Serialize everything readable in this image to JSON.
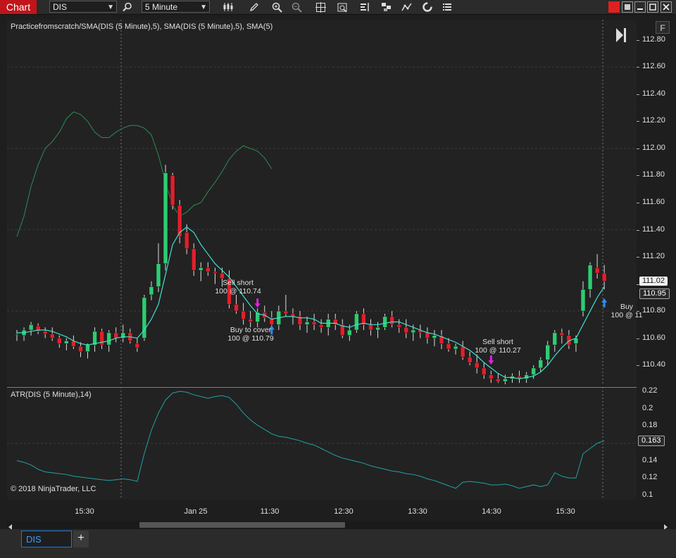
{
  "toolbar": {
    "tab_label": "Chart",
    "instrument": "DIS",
    "interval": "5 Minute",
    "icons": [
      "search-icon",
      "bar-type-icon",
      "pencil-icon",
      "zoom-in-icon",
      "zoom-out-icon",
      "crosshair-icon",
      "data-box-icon",
      "chart-trader-icon",
      "strategies-icon",
      "indicators-icon",
      "reload-icon",
      "properties-icon"
    ]
  },
  "window_controls": {
    "colors": {
      "link": "#e02020"
    }
  },
  "price_panel": {
    "title": "Practicefromscratch/SMA(DIS (5 Minute),5), SMA(DIS (5 Minute),5), SMA(5)",
    "f_label": "F",
    "price_ticks": [
      "112.80",
      "112.60",
      "112.40",
      "112.20",
      "112.00",
      "111.80",
      "111.60",
      "111.40",
      "111.20",
      "111.00",
      "110.80",
      "110.60",
      "110.40"
    ],
    "tags": [
      {
        "text": "111.02",
        "style": "white"
      },
      {
        "text": "110.95",
        "style": "dark"
      }
    ],
    "annotations": [
      {
        "line1": "Sell short",
        "line2": "100 @ 110.74"
      },
      {
        "line1": "Buy to cover",
        "line2": "100 @ 110.79"
      },
      {
        "line1": "Sell short",
        "line2": "100 @ 110.27"
      },
      {
        "line1": "Buy",
        "line2": "100 @ 11"
      }
    ]
  },
  "atr_panel": {
    "title": "ATR(DIS (5 Minute),14)",
    "ticks": [
      "0.22",
      "0.2",
      "0.18",
      "0.16",
      "0.14",
      "0.12",
      "0.1"
    ],
    "tag": "0.163",
    "copyright": "© 2018 NinjaTrader, LLC"
  },
  "time_axis": [
    "15:30",
    "Jan 25",
    "11:30",
    "12:30",
    "13:30",
    "14:30",
    "15:30"
  ],
  "bottom": {
    "tab": "DIS",
    "add": "+"
  },
  "chart_data": {
    "type": "candlestick",
    "instrument": "DIS",
    "interval": "5 Minute",
    "ylim": [
      110.25,
      112.95
    ],
    "candles": [
      {
        "o": 110.63,
        "h": 110.66,
        "l": 110.58,
        "c": 110.63
      },
      {
        "o": 110.62,
        "h": 110.68,
        "l": 110.58,
        "c": 110.66
      },
      {
        "o": 110.66,
        "h": 110.72,
        "l": 110.62,
        "c": 110.7
      },
      {
        "o": 110.69,
        "h": 110.71,
        "l": 110.63,
        "c": 110.65
      },
      {
        "o": 110.65,
        "h": 110.68,
        "l": 110.6,
        "c": 110.63
      },
      {
        "o": 110.63,
        "h": 110.68,
        "l": 110.58,
        "c": 110.6
      },
      {
        "o": 110.6,
        "h": 110.62,
        "l": 110.53,
        "c": 110.56
      },
      {
        "o": 110.56,
        "h": 110.6,
        "l": 110.51,
        "c": 110.58
      },
      {
        "o": 110.58,
        "h": 110.62,
        "l": 110.52,
        "c": 110.54
      },
      {
        "o": 110.54,
        "h": 110.57,
        "l": 110.46,
        "c": 110.5
      },
      {
        "o": 110.5,
        "h": 110.56,
        "l": 110.45,
        "c": 110.55
      },
      {
        "o": 110.55,
        "h": 110.68,
        "l": 110.5,
        "c": 110.65
      },
      {
        "o": 110.65,
        "h": 110.67,
        "l": 110.52,
        "c": 110.55
      },
      {
        "o": 110.55,
        "h": 110.66,
        "l": 110.5,
        "c": 110.64
      },
      {
        "o": 110.64,
        "h": 110.68,
        "l": 110.57,
        "c": 110.6
      },
      {
        "o": 110.6,
        "h": 110.7,
        "l": 110.57,
        "c": 110.64
      },
      {
        "o": 110.64,
        "h": 110.67,
        "l": 110.56,
        "c": 110.58
      },
      {
        "o": 110.56,
        "h": 110.6,
        "l": 110.5,
        "c": 110.53
      },
      {
        "o": 110.6,
        "h": 110.92,
        "l": 110.58,
        "c": 110.9
      },
      {
        "o": 110.92,
        "h": 111.02,
        "l": 110.88,
        "c": 110.98
      },
      {
        "o": 110.98,
        "h": 111.3,
        "l": 110.94,
        "c": 111.15
      },
      {
        "o": 111.15,
        "h": 111.88,
        "l": 111.1,
        "c": 111.82
      },
      {
        "o": 111.8,
        "h": 111.82,
        "l": 111.55,
        "c": 111.58
      },
      {
        "o": 111.58,
        "h": 111.62,
        "l": 111.3,
        "c": 111.35
      },
      {
        "o": 111.38,
        "h": 111.44,
        "l": 111.22,
        "c": 111.26
      },
      {
        "o": 111.26,
        "h": 111.3,
        "l": 111.06,
        "c": 111.1
      },
      {
        "o": 111.1,
        "h": 111.16,
        "l": 111.02,
        "c": 111.12
      },
      {
        "o": 111.12,
        "h": 111.16,
        "l": 111.06,
        "c": 111.09
      },
      {
        "o": 111.09,
        "h": 111.12,
        "l": 111.0,
        "c": 111.08
      },
      {
        "o": 111.08,
        "h": 111.12,
        "l": 110.98,
        "c": 111.04
      },
      {
        "o": 111.04,
        "h": 111.1,
        "l": 110.82,
        "c": 110.85
      },
      {
        "o": 110.85,
        "h": 110.92,
        "l": 110.78,
        "c": 110.8
      },
      {
        "o": 110.8,
        "h": 110.86,
        "l": 110.7,
        "c": 110.74
      },
      {
        "o": 110.74,
        "h": 110.8,
        "l": 110.68,
        "c": 110.72
      },
      {
        "o": 110.72,
        "h": 110.82,
        "l": 110.68,
        "c": 110.79
      },
      {
        "o": 110.79,
        "h": 110.84,
        "l": 110.72,
        "c": 110.75
      },
      {
        "o": 110.75,
        "h": 110.8,
        "l": 110.66,
        "c": 110.7
      },
      {
        "o": 110.7,
        "h": 110.84,
        "l": 110.66,
        "c": 110.8
      },
      {
        "o": 110.8,
        "h": 110.92,
        "l": 110.76,
        "c": 110.78
      },
      {
        "o": 110.78,
        "h": 110.82,
        "l": 110.7,
        "c": 110.76
      },
      {
        "o": 110.76,
        "h": 110.8,
        "l": 110.66,
        "c": 110.7
      },
      {
        "o": 110.7,
        "h": 110.76,
        "l": 110.64,
        "c": 110.72
      },
      {
        "o": 110.72,
        "h": 110.78,
        "l": 110.66,
        "c": 110.7
      },
      {
        "o": 110.7,
        "h": 110.74,
        "l": 110.64,
        "c": 110.68
      },
      {
        "o": 110.68,
        "h": 110.78,
        "l": 110.62,
        "c": 110.74
      },
      {
        "o": 110.74,
        "h": 110.78,
        "l": 110.66,
        "c": 110.7
      },
      {
        "o": 110.7,
        "h": 110.74,
        "l": 110.6,
        "c": 110.62
      },
      {
        "o": 110.62,
        "h": 110.7,
        "l": 110.58,
        "c": 110.66
      },
      {
        "o": 110.66,
        "h": 110.8,
        "l": 110.64,
        "c": 110.78
      },
      {
        "o": 110.78,
        "h": 110.82,
        "l": 110.66,
        "c": 110.7
      },
      {
        "o": 110.7,
        "h": 110.74,
        "l": 110.62,
        "c": 110.66
      },
      {
        "o": 110.66,
        "h": 110.72,
        "l": 110.6,
        "c": 110.68
      },
      {
        "o": 110.68,
        "h": 110.78,
        "l": 110.66,
        "c": 110.76
      },
      {
        "o": 110.76,
        "h": 110.8,
        "l": 110.68,
        "c": 110.7
      },
      {
        "o": 110.7,
        "h": 110.74,
        "l": 110.64,
        "c": 110.68
      },
      {
        "o": 110.68,
        "h": 110.74,
        "l": 110.6,
        "c": 110.64
      },
      {
        "o": 110.64,
        "h": 110.7,
        "l": 110.58,
        "c": 110.66
      },
      {
        "o": 110.66,
        "h": 110.7,
        "l": 110.6,
        "c": 110.64
      },
      {
        "o": 110.64,
        "h": 110.68,
        "l": 110.56,
        "c": 110.6
      },
      {
        "o": 110.6,
        "h": 110.66,
        "l": 110.54,
        "c": 110.62
      },
      {
        "o": 110.62,
        "h": 110.66,
        "l": 110.52,
        "c": 110.56
      },
      {
        "o": 110.56,
        "h": 110.6,
        "l": 110.5,
        "c": 110.52
      },
      {
        "o": 110.52,
        "h": 110.56,
        "l": 110.48,
        "c": 110.54
      },
      {
        "o": 110.54,
        "h": 110.58,
        "l": 110.44,
        "c": 110.46
      },
      {
        "o": 110.46,
        "h": 110.5,
        "l": 110.4,
        "c": 110.42
      },
      {
        "o": 110.42,
        "h": 110.48,
        "l": 110.34,
        "c": 110.38
      },
      {
        "o": 110.38,
        "h": 110.42,
        "l": 110.3,
        "c": 110.33
      },
      {
        "o": 110.33,
        "h": 110.36,
        "l": 110.27,
        "c": 110.3
      },
      {
        "o": 110.3,
        "h": 110.34,
        "l": 110.27,
        "c": 110.28
      },
      {
        "o": 110.28,
        "h": 110.33,
        "l": 110.26,
        "c": 110.3
      },
      {
        "o": 110.3,
        "h": 110.34,
        "l": 110.27,
        "c": 110.32
      },
      {
        "o": 110.32,
        "h": 110.36,
        "l": 110.27,
        "c": 110.3
      },
      {
        "o": 110.3,
        "h": 110.35,
        "l": 110.27,
        "c": 110.33
      },
      {
        "o": 110.33,
        "h": 110.4,
        "l": 110.3,
        "c": 110.38
      },
      {
        "o": 110.38,
        "h": 110.46,
        "l": 110.35,
        "c": 110.44
      },
      {
        "o": 110.44,
        "h": 110.58,
        "l": 110.4,
        "c": 110.55
      },
      {
        "o": 110.55,
        "h": 110.66,
        "l": 110.5,
        "c": 110.64
      },
      {
        "o": 110.64,
        "h": 110.67,
        "l": 110.56,
        "c": 110.62
      },
      {
        "o": 110.62,
        "h": 110.66,
        "l": 110.52,
        "c": 110.55
      },
      {
        "o": 110.56,
        "h": 110.62,
        "l": 110.5,
        "c": 110.6
      },
      {
        "o": 110.8,
        "h": 111.02,
        "l": 110.76,
        "c": 110.96
      },
      {
        "o": 110.96,
        "h": 111.16,
        "l": 110.9,
        "c": 111.14
      },
      {
        "o": 111.12,
        "h": 111.22,
        "l": 111.04,
        "c": 111.08
      },
      {
        "o": 111.08,
        "h": 111.14,
        "l": 110.96,
        "c": 111.02
      }
    ],
    "sma": [
      110.64,
      110.64,
      110.65,
      110.66,
      110.66,
      110.65,
      110.63,
      110.61,
      110.58,
      110.56,
      110.55,
      110.56,
      110.57,
      110.58,
      110.6,
      110.61,
      110.61,
      110.6,
      110.66,
      110.74,
      110.85,
      111.07,
      111.29,
      111.38,
      111.42,
      111.38,
      111.29,
      111.22,
      111.15,
      111.1,
      111.05,
      110.98,
      110.91,
      110.84,
      110.78,
      110.77,
      110.74,
      110.75,
      110.76,
      110.76,
      110.75,
      110.75,
      110.74,
      110.71,
      110.71,
      110.71,
      110.69,
      110.68,
      110.7,
      110.71,
      110.7,
      110.7,
      110.71,
      110.72,
      110.72,
      110.7,
      110.68,
      110.66,
      110.64,
      110.63,
      110.61,
      110.59,
      110.57,
      110.54,
      110.51,
      110.47,
      110.42,
      110.38,
      110.34,
      110.31,
      110.31,
      110.3,
      110.31,
      110.32,
      110.35,
      110.4,
      110.47,
      110.53,
      110.58,
      110.6,
      110.7,
      110.8,
      110.9,
      110.98
    ],
    "band": [
      111.35,
      111.5,
      111.72,
      111.88,
      112.0,
      112.05,
      112.12,
      112.22,
      112.27,
      112.25,
      112.2,
      112.12,
      112.08,
      112.08,
      112.12,
      112.15,
      112.17,
      112.17,
      112.15,
      112.1,
      111.95,
      111.75,
      111.58,
      111.5,
      111.53,
      111.58,
      111.6,
      111.68,
      111.75,
      111.83,
      111.92,
      111.98,
      112.02,
      112.0,
      111.98,
      111.93,
      111.85
    ],
    "atr": [
      0.14,
      0.138,
      0.135,
      0.13,
      0.127,
      0.126,
      0.125,
      0.124,
      0.122,
      0.121,
      0.12,
      0.119,
      0.118,
      0.117,
      0.118,
      0.119,
      0.118,
      0.116,
      0.148,
      0.175,
      0.195,
      0.21,
      0.218,
      0.22,
      0.219,
      0.216,
      0.214,
      0.212,
      0.214,
      0.215,
      0.213,
      0.205,
      0.195,
      0.187,
      0.181,
      0.176,
      0.171,
      0.168,
      0.167,
      0.165,
      0.163,
      0.16,
      0.158,
      0.154,
      0.15,
      0.146,
      0.143,
      0.141,
      0.139,
      0.137,
      0.134,
      0.132,
      0.13,
      0.128,
      0.127,
      0.125,
      0.124,
      0.122,
      0.119,
      0.117,
      0.114,
      0.111,
      0.108,
      0.115,
      0.116,
      0.115,
      0.114,
      0.112,
      0.112,
      0.113,
      0.111,
      0.108,
      0.11,
      0.112,
      0.11,
      0.112,
      0.126,
      0.122,
      0.12,
      0.12,
      0.148,
      0.154,
      0.16,
      0.163
    ],
    "price_range": [
      110.25,
      112.95
    ],
    "atr_range": [
      0.095,
      0.225
    ],
    "time_labels": [
      "15:30",
      "Jan 25",
      "11:30",
      "12:30",
      "13:30",
      "14:30",
      "15:30"
    ],
    "trade_markers": [
      {
        "bar": 34,
        "type": "sell",
        "price": 110.82
      },
      {
        "bar": 36,
        "type": "buy",
        "price": 110.7
      },
      {
        "bar": 67,
        "type": "sell",
        "price": 110.4
      },
      {
        "bar": 83,
        "type": "buy",
        "price": 110.9
      }
    ]
  },
  "colors": {
    "background": "#222222",
    "up": "#2ecc71",
    "down": "#e0202a",
    "sma": "#40e0d0",
    "band": "#2e8b57",
    "atr": "#21a1a6",
    "grid": "#3a3a3a"
  }
}
